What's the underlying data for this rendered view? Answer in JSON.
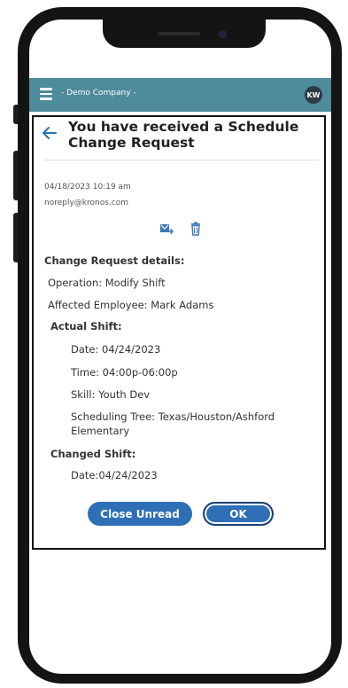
{
  "header": {
    "company": "- Demo Company -",
    "avatar_initials": "KW"
  },
  "message": {
    "title": "You have received a Schedule Change Request",
    "date": "04/18/2023 10:19 am",
    "sender": "noreply@kronos.com",
    "details_heading": "Change Request details:",
    "operation": "Operation: Modify Shift",
    "affected_employee": "Affected Employee: Mark Adams",
    "actual_shift_heading": "Actual Shift:",
    "actual_date": "Date: 04/24/2023",
    "actual_time": "Time: 04:00p-06:00p",
    "actual_skill": "Skill: Youth Dev",
    "actual_tree_line1": "Scheduling Tree: Texas/Houston/Ashford",
    "actual_tree_line2": "Elementary",
    "changed_shift_heading": "Changed Shift:",
    "changed_date": "Date:04/24/2023"
  },
  "actions": {
    "close_unread": "Close Unread",
    "ok": "OK"
  },
  "icons": [
    "menu-icon",
    "back-arrow-icon",
    "move-icon",
    "trash-icon"
  ],
  "colors": {
    "header_bg": "#4e8b9b",
    "button_bg": "#2e6fb6"
  }
}
